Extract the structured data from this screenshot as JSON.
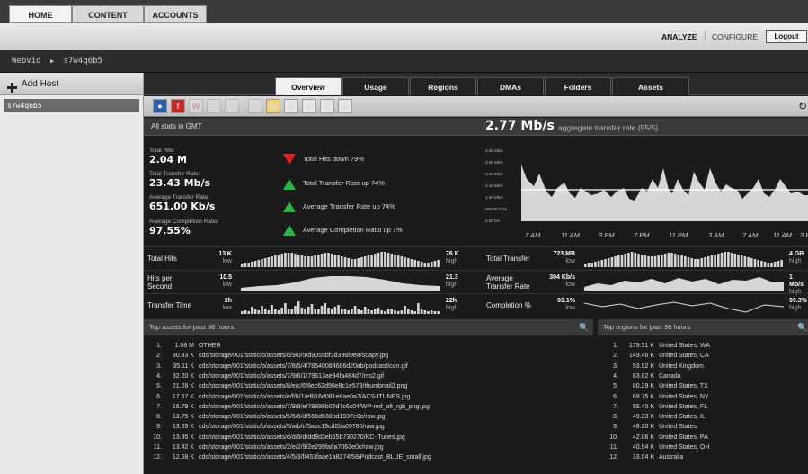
{
  "top_tabs": [
    "HOME",
    "CONTENT",
    "ACCOUNTS"
  ],
  "header": {
    "analyze": "ANALYZE",
    "configure": "CONFIGURE",
    "logout": "Logout"
  },
  "breadcrumb": {
    "root": "WebVid",
    "host": "s7w4q6b5"
  },
  "sidebar": {
    "add_host": "Add Host",
    "host": "s7w4q6b5"
  },
  "view_tabs": [
    "Overview",
    "Usage",
    "Regions",
    "DMAs",
    "Folders",
    "Assets"
  ],
  "stats": {
    "timezone": "All stats in GMT",
    "rate_value": "2.77 Mb/s",
    "rate_label": "aggregate transfer rate (95/5)",
    "summary": [
      {
        "label": "Total Hits:",
        "value": "2.04 M",
        "trend": "down",
        "trend_text": "Total Hits down 79%"
      },
      {
        "label": "Total Transfer Rate:",
        "value": "23.43 Mb/s",
        "trend": "up",
        "trend_text": "Total Transfer Rate up 74%"
      },
      {
        "label": "Average Transfer Rate:",
        "value": "651.00 Kb/s",
        "trend": "up",
        "trend_text": "Average Transfer Rate up 74%"
      },
      {
        "label": "Average Completion Ratio:",
        "value": "97.55%",
        "trend": "up",
        "trend_text": "Average Completion Ratio up 1%"
      }
    ],
    "chart_y_ticks": [
      "4.80 Mb/s",
      "4.00 Mb/s",
      "3.20 Mb/s",
      "2.40 Mb/s",
      "1.60 Mb/s",
      "800.00 Kb/s",
      "0.00 b/s"
    ],
    "chart_x_ticks": [
      "7 AM",
      "11 AM",
      "3 PM",
      "7 PM",
      "11 PM",
      "3 AM",
      "7 AM",
      "11 AM",
      "3 PM"
    ]
  },
  "spark_rows": [
    {
      "label": "Total Hits",
      "min": "13 K",
      "min_sub": "low",
      "max": "76 K",
      "max_sub": "high"
    },
    {
      "label": "Hits per Second",
      "min": "10.5",
      "min_sub": "low",
      "max": "21.3",
      "max_sub": "high"
    },
    {
      "label": "Transfer Time",
      "min": "2h",
      "min_sub": "low",
      "max": "22h",
      "max_sub": "high"
    }
  ],
  "spark_rows_right": [
    {
      "label": "Total Transfer",
      "min": "723 MB",
      "min_sub": "low",
      "max": "4 GB",
      "max_sub": "high"
    },
    {
      "label": "Average Transfer Rate",
      "min": "304 Kb/s",
      "min_sub": "low",
      "max": "1 Mb/s",
      "max_sub": "high"
    },
    {
      "label": "Completion %",
      "min": "93.1%",
      "min_sub": "low",
      "max": "99.3%",
      "max_sub": "high"
    }
  ],
  "assets": {
    "title": "Top assets for past 36 hours",
    "items": [
      {
        "n": "1.",
        "v": "1.08 M",
        "name": "OTHER"
      },
      {
        "n": "2.",
        "v": "80.83 K",
        "name": "cds/storage/001/static/p/assets/d/9/0/5/d9055bf3d396f9ea/soapy.jpg"
      },
      {
        "n": "3.",
        "v": "35.11 K",
        "name": "cds/storage/001/static/p/assets/7/8/5/4/78540084686d20ab/podcastIcon.gif"
      },
      {
        "n": "4.",
        "v": "32.20 K",
        "name": "cds/storage/001/static/p/assets/7/9/6/1/79613ae94fa484d7/rss2.gif"
      },
      {
        "n": "5.",
        "v": "21.26 K",
        "name": "cds/storage/001/static/p/assets/8/e/c/6/8ec62d98e8c1e573/thumbnail2.png"
      },
      {
        "n": "6.",
        "v": "17.67 K",
        "name": "cds/storage/001/static/p/assets/e/f/6/1/ef616d081e8ae0a7/ACS-ITUNES.jpg"
      },
      {
        "n": "7.",
        "v": "16.79 K",
        "name": "cds/storage/001/static/p/assets/7/9/8/e/79895b02d7c6c04/WP-red_alt_rgb_png.jpg"
      },
      {
        "n": "8.",
        "v": "13.75 K",
        "name": "cds/storage/001/static/p/assets/5/6/6/d/566d638bd1937e0c/raw.jpg"
      },
      {
        "n": "9.",
        "v": "13.69 K",
        "name": "cds/storage/001/static/p/assets/5/a/b/c/5abc19cd2ba09785/raw.jpg"
      },
      {
        "n": "10.",
        "v": "13.45 K",
        "name": "cds/storage/001/static/p/assets/d/d/9/d/dd9d3eb65b730270/KC-iTunes.jpg"
      },
      {
        "n": "11.",
        "v": "13.42 K",
        "name": "cds/storage/001/static/p/assets/2/e/2/9/2e299fa0a7063e0c/raw.jpg"
      },
      {
        "n": "12.",
        "v": "12.58 K",
        "name": "cds/storage/001/static/p/assets/4/5/3/f/453faae1a8274f58/Podcast_BLUE_small.jpg"
      }
    ]
  },
  "regions": {
    "title": "Top regions for past 36 hours",
    "items": [
      {
        "n": "1.",
        "v": "179.51 K",
        "name": "United States, WA"
      },
      {
        "n": "2.",
        "v": "149.46 K",
        "name": "United States, CA"
      },
      {
        "n": "3.",
        "v": "93.92 K",
        "name": "United Kingdom"
      },
      {
        "n": "4.",
        "v": "83.82 K",
        "name": "Canada"
      },
      {
        "n": "5.",
        "v": "80.29 K",
        "name": "United States, TX"
      },
      {
        "n": "6.",
        "v": "69.75 K",
        "name": "United States, NY"
      },
      {
        "n": "7.",
        "v": "55.40 K",
        "name": "United States, FL"
      },
      {
        "n": "8.",
        "v": "49.33 K",
        "name": "United States, IL"
      },
      {
        "n": "9.",
        "v": "48.20 K",
        "name": "United States"
      },
      {
        "n": "10.",
        "v": "42.06 K",
        "name": "United States, PA"
      },
      {
        "n": "11.",
        "v": "40.94 K",
        "name": "United States, OH"
      },
      {
        "n": "12.",
        "v": "33.04 K",
        "name": "Australia"
      }
    ]
  },
  "colors": {
    "up": "#2db34a",
    "down": "#e02020",
    "accent": "#ffffff"
  }
}
